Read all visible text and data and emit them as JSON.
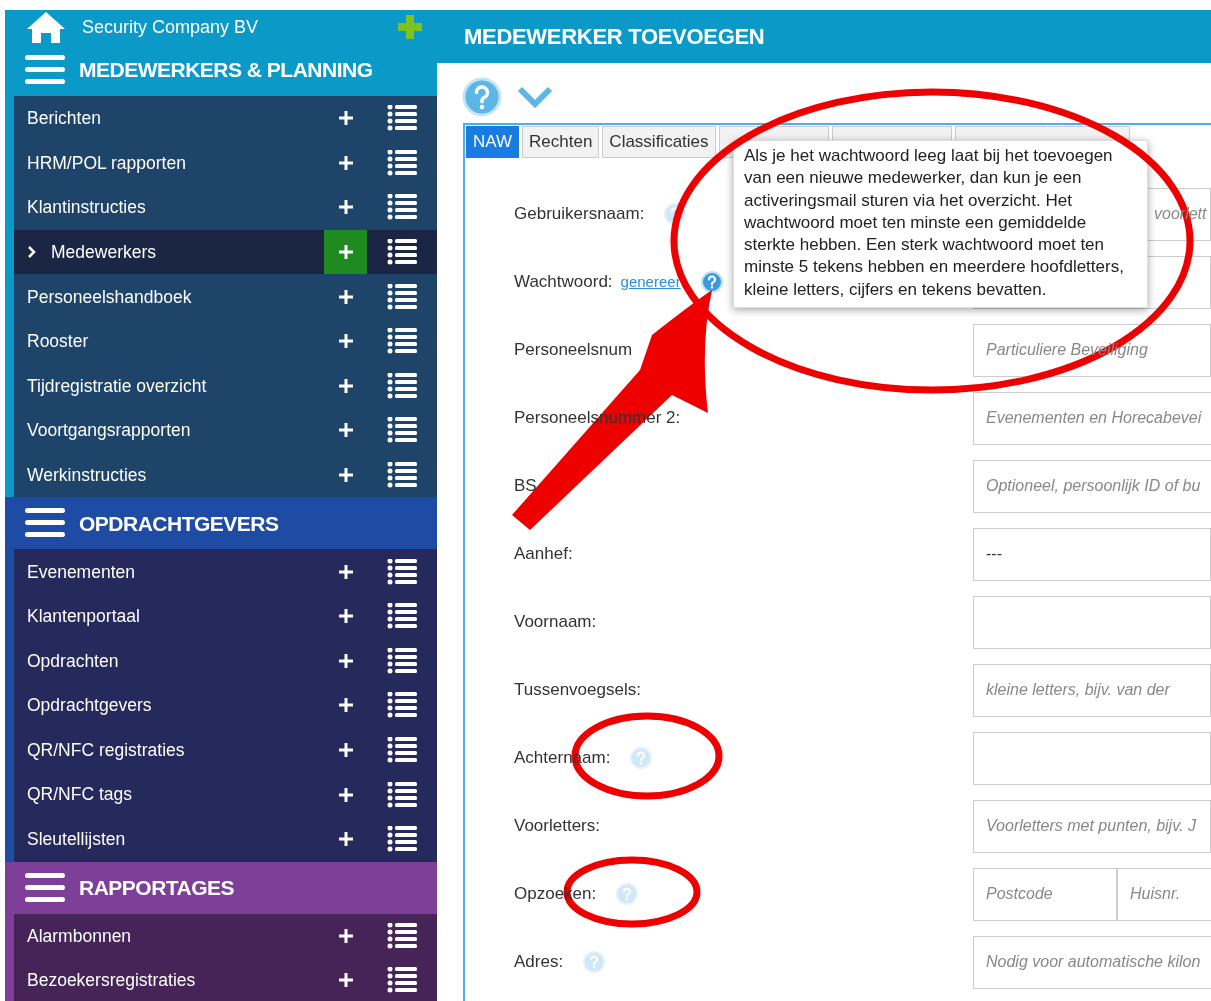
{
  "header": {
    "company": "Security Company BV"
  },
  "sections": [
    {
      "title": "MEDEWERKERS & PLANNING",
      "color": "#0b9ac8",
      "items": [
        {
          "label": "Berichten",
          "selected": false
        },
        {
          "label": "HRM/POL rapporten",
          "selected": false
        },
        {
          "label": "Klantinstructies",
          "selected": false
        },
        {
          "label": "Medewerkers",
          "selected": true
        },
        {
          "label": "Personeelshandboek",
          "selected": false
        },
        {
          "label": "Rooster",
          "selected": false
        },
        {
          "label": "Tijdregistratie overzicht",
          "selected": false
        },
        {
          "label": "Voortgangsrapporten",
          "selected": false
        },
        {
          "label": "Werkinstructies",
          "selected": false
        }
      ]
    },
    {
      "title": "OPDRACHTGEVERS",
      "color": "#1e4ba3",
      "items": [
        {
          "label": "Evenementen",
          "selected": false
        },
        {
          "label": "Klantenportaal",
          "selected": false
        },
        {
          "label": "Opdrachten",
          "selected": false
        },
        {
          "label": "Opdrachtgevers",
          "selected": false
        },
        {
          "label": "QR/NFC registraties",
          "selected": false
        },
        {
          "label": "QR/NFC tags",
          "selected": false
        },
        {
          "label": "Sleutellijsten",
          "selected": false
        }
      ]
    },
    {
      "title": "RAPPORTAGES",
      "color": "#7e3f98",
      "items": [
        {
          "label": "Alarmbonnen",
          "selected": false
        },
        {
          "label": "Bezoekersregistraties",
          "selected": false
        }
      ]
    }
  ],
  "page": {
    "title": "MEDEWERKER TOEVOEGEN"
  },
  "tabs": [
    {
      "label": "NAW",
      "selected": true
    },
    {
      "label": "Rechten",
      "selected": false
    },
    {
      "label": "Classificaties",
      "selected": false
    }
  ],
  "tooltip": "Als je het wachtwoord leeg laat bij het toevoegen van een nieuwe medewerker, dan kun je een activeringsmail sturen via het overzicht. Het wachtwoord moet ten minste een gemiddelde sterkte hebben. Een sterk wachtwoord moet ten minste 5 tekens hebben en meerdere hoofdletters, kleine letters, cijfers en tekens bevatten.",
  "form": [
    {
      "label": "Gebruikersnaam:",
      "help": true,
      "fields": [
        {
          "kind": "covered",
          "placeholder": "voorlett"
        }
      ]
    },
    {
      "label": "Wachtwoord:",
      "link": "genereer",
      "help": true,
      "fields": [
        {
          "kind": "input"
        }
      ]
    },
    {
      "label": "Personeelsnum",
      "help": false,
      "fields": [
        {
          "placeholder": "Particuliere Beveiliging"
        }
      ]
    },
    {
      "label": "Personeelsnummer 2:",
      "help": false,
      "fields": [
        {
          "placeholder": "Evenementen en Horecabevei"
        }
      ]
    },
    {
      "label": "BS",
      "help": false,
      "fields": [
        {
          "placeholder": "Optioneel, persoonlijk ID of bu"
        }
      ]
    },
    {
      "label": "Aanhef:",
      "help": false,
      "fields": [
        {
          "value": "---"
        }
      ]
    },
    {
      "label": "Voornaam:",
      "help": false,
      "fields": [
        {
          "kind": "input"
        }
      ]
    },
    {
      "label": "Tussenvoegsels:",
      "help": false,
      "fields": [
        {
          "placeholder": "kleine letters, bijv. van der"
        }
      ]
    },
    {
      "label": "Achternaam:",
      "help": true,
      "fields": [
        {
          "kind": "input"
        }
      ]
    },
    {
      "label": "Voorletters:",
      "help": false,
      "fields": [
        {
          "placeholder": "Voorletters met punten, bijv. J"
        }
      ]
    },
    {
      "label": "Opzoeken:",
      "help": true,
      "fields": [
        {
          "placeholder": "Postcode"
        },
        {
          "placeholder": "Huisnr."
        }
      ]
    },
    {
      "label": "Adres:",
      "help": true,
      "fields": [
        {
          "placeholder": "Nodig voor automatische kilon"
        }
      ]
    }
  ]
}
